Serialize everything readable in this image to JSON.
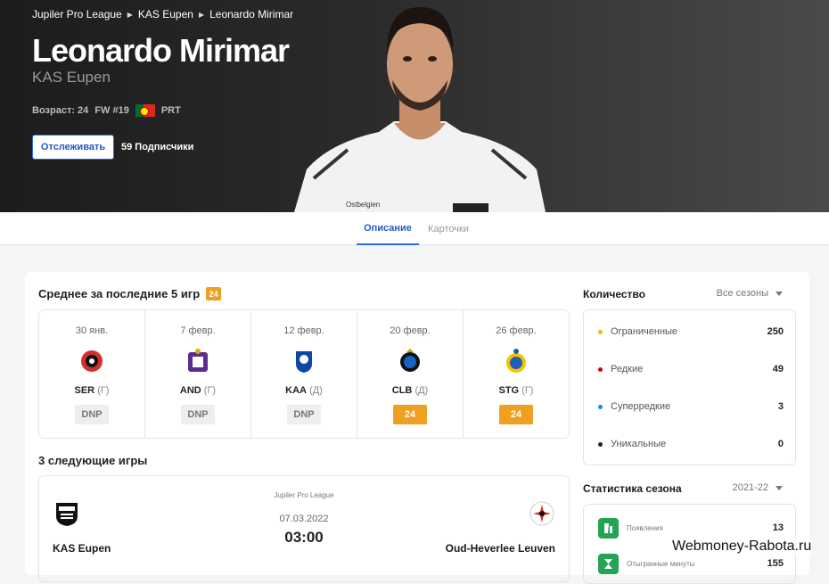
{
  "breadcrumb": [
    "Jupiler Pro League",
    "KAS Eupen",
    "Leonardo Mirimar"
  ],
  "player": {
    "name": "Leonardo Mirimar",
    "club": "KAS Eupen",
    "age": "Возраст: 24",
    "position": "FW #19",
    "nationality": "PRT"
  },
  "follow_button": "Отслеживать",
  "followers": "59 Подписчики",
  "tabs": [
    "Описание",
    "Карточки"
  ],
  "last5": {
    "title": "Среднее за последние 5 игр",
    "avg": "24",
    "games": [
      {
        "date": "30 янв.",
        "team": "SER",
        "venue": "(Г)",
        "score": "DNP",
        "logo": "seraing-logo"
      },
      {
        "date": "7 февр.",
        "team": "AND",
        "venue": "(Г)",
        "score": "DNP",
        "logo": "anderlecht-logo"
      },
      {
        "date": "12 февр.",
        "team": "KAA",
        "venue": "(Д)",
        "score": "DNP",
        "logo": "gent-logo"
      },
      {
        "date": "20 февр.",
        "team": "CLB",
        "venue": "(Д)",
        "score": "24",
        "logo": "brugge-logo"
      },
      {
        "date": "26 февр.",
        "team": "STG",
        "venue": "(Г)",
        "score": "24",
        "logo": "union-logo"
      }
    ]
  },
  "upcoming": {
    "title": "3 следующие игры",
    "league": "Jupiler Pro League",
    "date": "07.03.2022",
    "time": "03:00",
    "home": "KAS Eupen",
    "away": "Oud-Heverlee Leuven"
  },
  "quantity": {
    "title": "Количество",
    "filter": "Все сезоны",
    "rows": [
      {
        "label": "Ограниченные",
        "value": "250",
        "color": "#f2b705"
      },
      {
        "label": "Редкие",
        "value": "49",
        "color": "#d0021b"
      },
      {
        "label": "Суперредкие",
        "value": "3",
        "color": "#1e88e5"
      },
      {
        "label": "Уникальные",
        "value": "0",
        "color": "#222222"
      }
    ]
  },
  "season": {
    "title": "Статистика сезона",
    "filter": "2021-22",
    "rows": [
      {
        "label": "Появления",
        "value": "13"
      },
      {
        "label": "Отыгранные минуты",
        "value": "155"
      }
    ]
  },
  "watermark": "Webmoney-Rabota.ru",
  "colors": {
    "accent": "#2d6be0",
    "score": "#f0a020",
    "stat_icon": "#23a455"
  }
}
